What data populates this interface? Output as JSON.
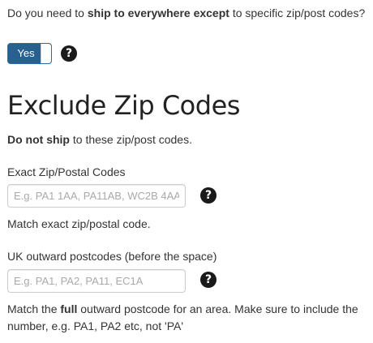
{
  "question": {
    "prefix": "Do you need to ",
    "bold": "ship to everywhere except",
    "suffix": " to specific zip/post codes?"
  },
  "toggle": {
    "label": "Yes",
    "state": "on"
  },
  "help_icon_glyph": "?",
  "heading": "Exclude Zip Codes",
  "subline": {
    "bold": "Do not ship",
    "rest": " to these zip/post codes."
  },
  "exact_codes": {
    "label": "Exact Zip/Postal Codes",
    "placeholder": "E.g. PA1 1AA, PA11AB, WC2B 4AA",
    "value": "",
    "note": "Match exact zip/postal code."
  },
  "outward_codes": {
    "label": "UK outward postcodes (before the space)",
    "placeholder": "E.g. PA1, PA2, PA11, EC1A",
    "value": "",
    "note_prefix": "Match the ",
    "note_bold": "full",
    "note_suffix": " outward postcode for an area. Make sure to include the number, e.g. PA1, PA2 etc, not 'PA'"
  }
}
